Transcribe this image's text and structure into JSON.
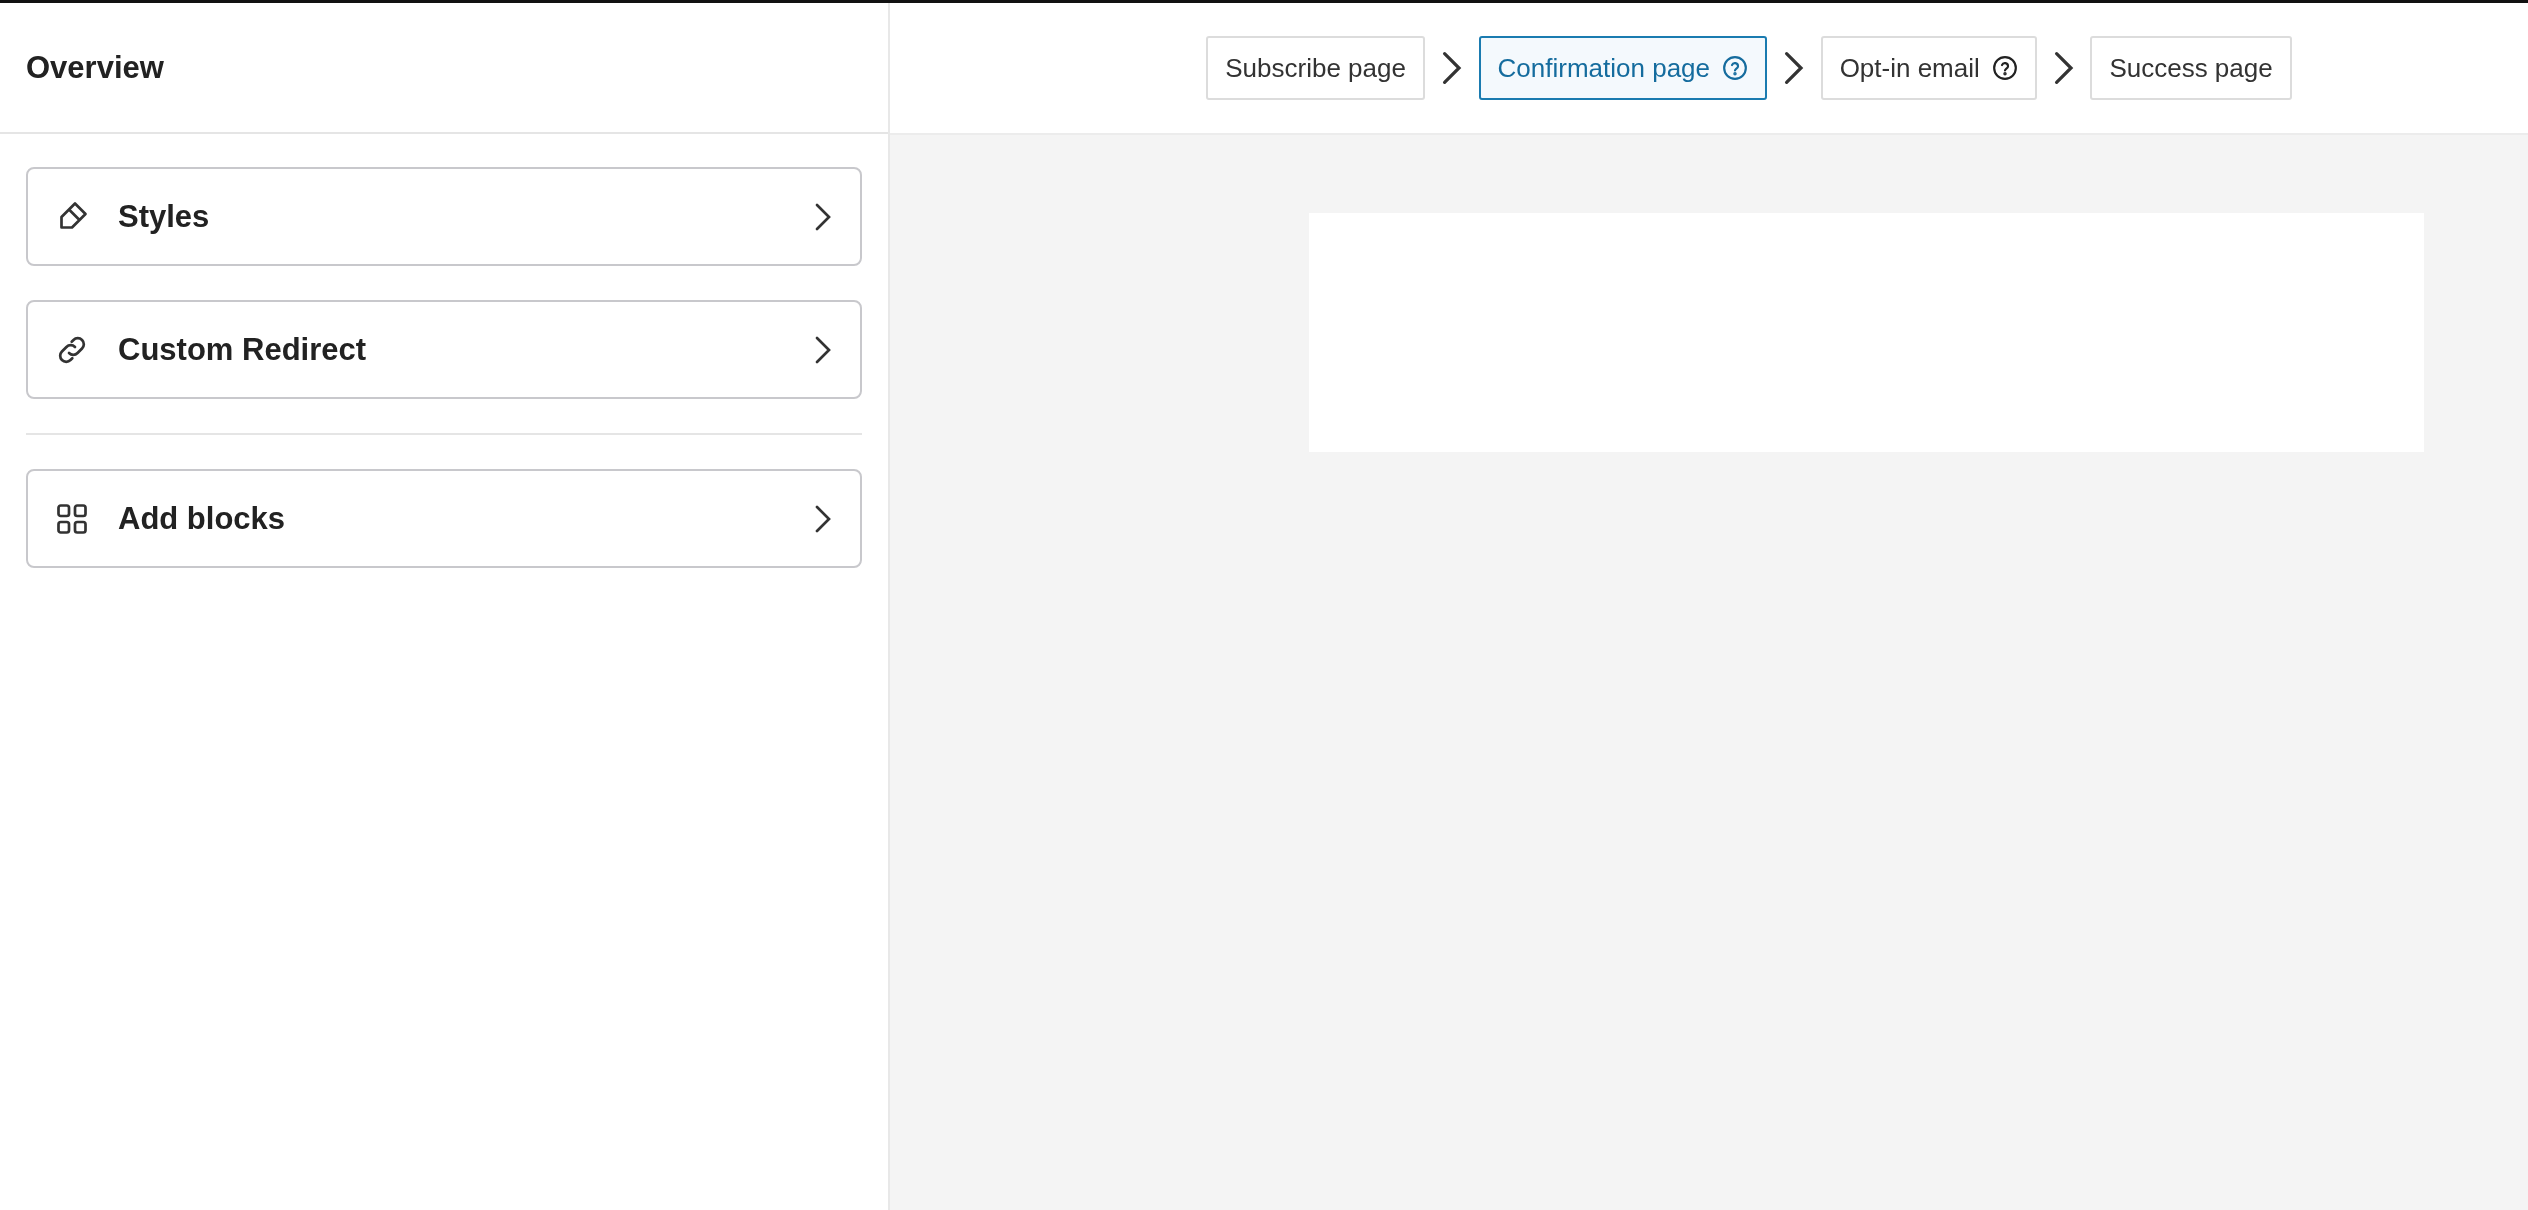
{
  "sidebar": {
    "title": "Overview",
    "items": [
      {
        "label": "Styles",
        "kind": "pencil"
      },
      {
        "label": "Custom Redirect",
        "kind": "link"
      },
      {
        "label": "Add blocks",
        "kind": "blocks"
      }
    ]
  },
  "steps": [
    {
      "label": "Subscribe page",
      "selected": false,
      "help": false
    },
    {
      "label": "Confirmation page",
      "selected": true,
      "help": true
    },
    {
      "label": "Opt-in email",
      "selected": false,
      "help": true
    },
    {
      "label": "Success page",
      "selected": false,
      "help": false
    }
  ]
}
